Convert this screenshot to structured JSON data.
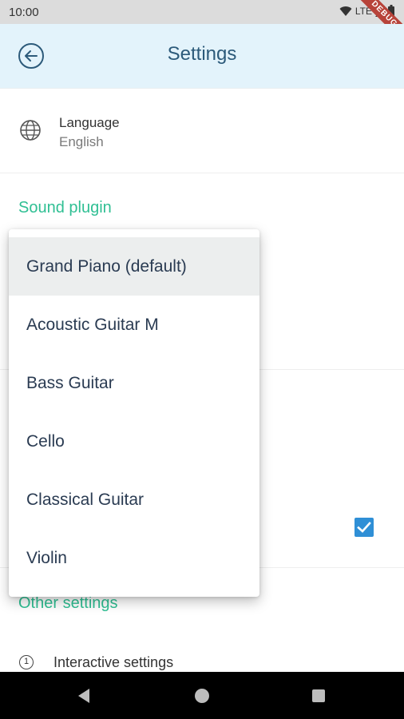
{
  "status_bar": {
    "time": "10:00",
    "network": "LTE",
    "debug_label": "DEBUG"
  },
  "app_bar": {
    "title": "Settings"
  },
  "language": {
    "title": "Language",
    "value": "English"
  },
  "sections": {
    "sound_plugin": "Sound plugin",
    "other_settings": "Other settings"
  },
  "other": {
    "interactive_label": "Interactive settings",
    "interactive_number": "1"
  },
  "dropdown": {
    "selected": "Grand Piano (default)",
    "options": [
      "Grand Piano (default)",
      "Acoustic Guitar M",
      "Bass Guitar",
      "Cello",
      "Classical Guitar",
      "Violin"
    ]
  },
  "colors": {
    "app_bar_bg": "#e3f3fb",
    "accent_green": "#2fbf93",
    "title_blue": "#2c5a7a",
    "checkbox_blue": "#2f8fd6"
  }
}
